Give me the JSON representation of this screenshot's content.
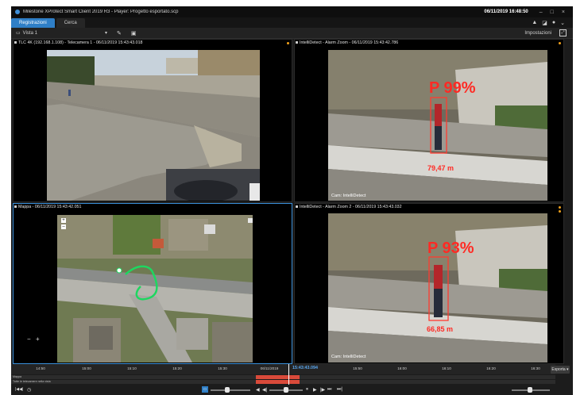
{
  "window": {
    "title": "Milestone XProtect Smart Client 2019 R3 - Player: Progetto esportato.scp",
    "clock": "06/11/2019 16:48:50",
    "controls": [
      "–",
      "□",
      "×"
    ]
  },
  "modes": {
    "tabs": [
      {
        "label": "Registrazioni",
        "active": true
      },
      {
        "label": "Cerca",
        "active": false
      }
    ],
    "right_icons": [
      "▲",
      "◪",
      "●",
      "⌄"
    ]
  },
  "toolbar": {
    "view_label": "Vista 1",
    "settings_label": "Impostazioni"
  },
  "panes": [
    {
      "id": "tl",
      "title": "TLC 4K (192.168.1.108) - Telecamera 1 - 06/11/2019 15:43:43.018",
      "selected": false
    },
    {
      "id": "tr",
      "title": "IntelliDetect - Alarm Zoom - 06/11/2019 15:43:42.786",
      "selected": false,
      "overlay_percent": "P 99%",
      "overlay_distance": "79,47 m",
      "watermark": "Cam: IntelliDetect"
    },
    {
      "id": "bl",
      "title": "Mappa - 06/11/2019 15:43:42.051",
      "selected": true,
      "zoom_in": "+",
      "zoom_out": "–",
      "map_btn_minus": "−",
      "map_btn_plus": "+"
    },
    {
      "id": "br",
      "title": "IntelliDetect - Alarm Zoom 2 - 06/11/2019 15:43:43.032",
      "selected": false,
      "overlay_percent": "P 93%",
      "overlay_distance": "66,85 m",
      "watermark": "Cam: IntelliDetect"
    }
  ],
  "timeline": {
    "ticks": [
      "14:50",
      "15:00",
      "15:10",
      "15:20",
      "15:30",
      "06/11/2019",
      "15:43:43.094",
      "15:50",
      "16:00",
      "16:10",
      "16:20",
      "16:30",
      "16:40"
    ],
    "track_labels": [
      "Mappa",
      "Tutte le telecamere nella vista"
    ],
    "export_label": "Esporta ▾",
    "controls": [
      "⏮",
      "◀",
      "◀|",
      "⏸",
      "▶",
      "|▶",
      "⏭",
      "⏭|"
    ],
    "left_icons": [
      "|◀◀|",
      "◷"
    ]
  }
}
